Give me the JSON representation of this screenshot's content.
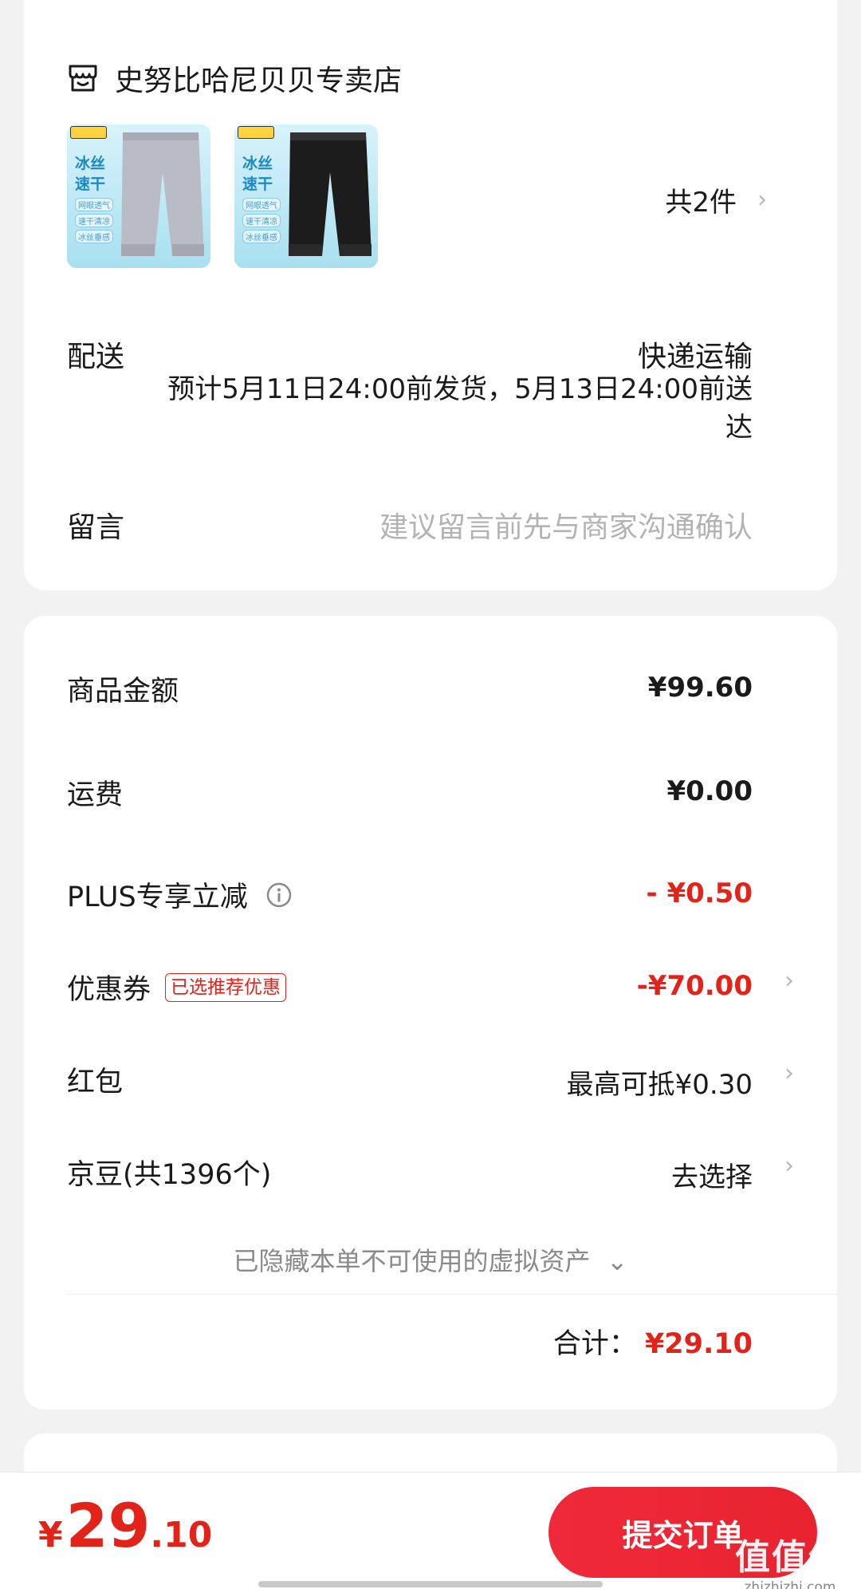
{
  "store": {
    "name": "史努比哈尼贝贝专卖店",
    "icon": "store-icon"
  },
  "products": {
    "items": [
      {
        "brand": "SNOOPY",
        "tag_title": "冰丝速干",
        "tags": [
          "网眼透气",
          "速干清凉",
          "冰丝垂感"
        ],
        "color": "#b9bcc5"
      },
      {
        "brand": "SNOOPY",
        "tag_title": "冰丝速干",
        "tags": [
          "网眼透气",
          "速干清凉",
          "冰丝垂感"
        ],
        "color": "#1c1c1c"
      }
    ],
    "count_label": "共2件"
  },
  "delivery": {
    "label": "配送",
    "method": "快递运输",
    "detail": "预计5月11日24:00前发货，5月13日24:00前送达"
  },
  "message": {
    "label": "留言",
    "placeholder": "建议留言前先与商家沟通确认"
  },
  "pricing": {
    "goods_amount_label": "商品金额",
    "goods_amount": "¥99.60",
    "shipping_label": "运费",
    "shipping": "¥0.00",
    "plus_label": "PLUS专享立减",
    "plus_discount": "- ¥0.50",
    "coupon_label": "优惠券",
    "coupon_badge": "已选推荐优惠",
    "coupon_discount": "-¥70.00",
    "red_packet_label": "红包",
    "red_packet": "最高可抵¥0.30",
    "jingdou_label": "京豆(共1396个)",
    "jingdou_action": "去选择",
    "hidden_assets": "已隐藏本单不可使用的虚拟资产",
    "total_label": "合计：",
    "total": "¥29.10"
  },
  "bottom": {
    "price_symbol": "¥",
    "price_int": "29",
    "price_dec": ".10",
    "submit_label": "提交订单"
  },
  "watermark": {
    "logo": "值",
    "site": "zhizhizhi.com"
  },
  "colors": {
    "accent": "#e2231a",
    "background": "#f2f2f2",
    "card": "#ffffff"
  }
}
